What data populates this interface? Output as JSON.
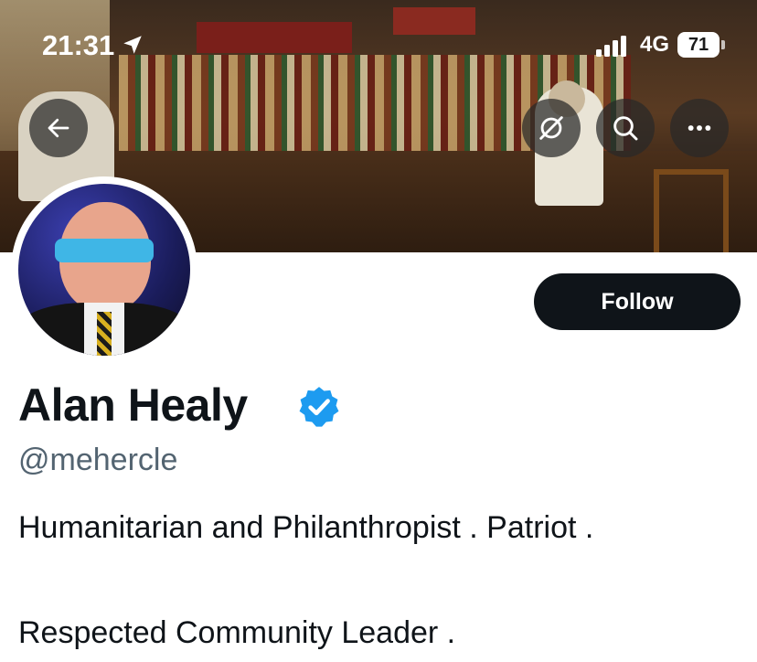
{
  "status_bar": {
    "time": "21:31",
    "network": "4G",
    "battery": "71"
  },
  "header": {
    "back_icon": "arrow-left-icon",
    "private_icon": "eye-slash-icon",
    "search_icon": "search-icon",
    "more_icon": "more-icon"
  },
  "profile": {
    "display_name": "Alan Healy",
    "handle": "@mehercle",
    "verified": true,
    "verified_color": "#1d9bf0",
    "follow_label": "Follow",
    "bio": [
      "Humanitarian and Philanthropist . Patriot .",
      "Respected Community Leader ."
    ]
  },
  "colors": {
    "primary_text": "#0f1419",
    "secondary_text": "#536471",
    "button_bg": "#0f1419"
  }
}
